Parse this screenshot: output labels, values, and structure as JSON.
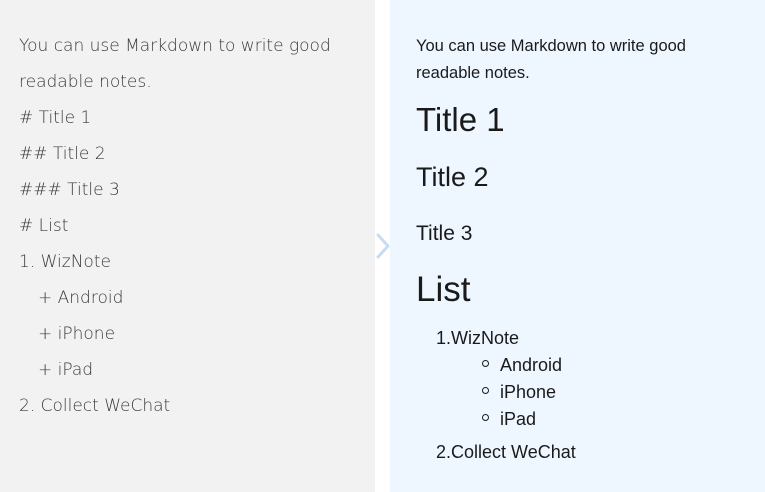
{
  "editor": {
    "intro": "You can use Markdown to write good readable notes.",
    "lines": [
      "# Title 1",
      "## Title 2",
      "### Title 3",
      "# List",
      "1. WizNote",
      "+ Android",
      "+ iPhone",
      "+ iPad",
      "2. Collect WeChat"
    ]
  },
  "preview": {
    "intro": "You can use Markdown to write good readable notes.",
    "title1": "Title 1",
    "title2": "Title 2",
    "title3": "Title 3",
    "list_heading": "List",
    "item1": "1.WizNote",
    "subitems": [
      "Android",
      "iPhone",
      "iPad"
    ],
    "item2": "2.Collect WeChat"
  },
  "divider_icon": "chevron-right-icon",
  "colors": {
    "editor_bg": "#f2f2f2",
    "preview_bg": "#eef6ff",
    "chevron": "#c9daf2"
  }
}
